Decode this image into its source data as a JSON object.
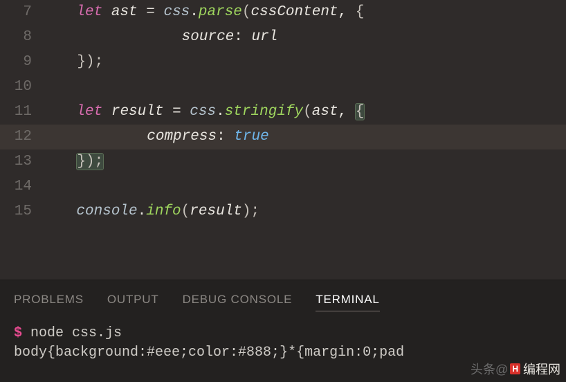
{
  "editor": {
    "lineNumbers": [
      "7",
      "8",
      "9",
      "10",
      "11",
      "12",
      "13",
      "14",
      "15"
    ],
    "l7": {
      "let": "let",
      "ast": "ast",
      "eq": " = ",
      "css": "css",
      "dot": ".",
      "parse": "parse",
      "open": "(",
      "cssContent": "cssContent",
      "comma": ", ",
      "brace": "{"
    },
    "l8": {
      "pad": "            ",
      "source": "source",
      "colon": ": ",
      "url": "url"
    },
    "l9": {
      "pad": "    ",
      "close": "});"
    },
    "l11": {
      "let": "let",
      "result": "result",
      "eq": " = ",
      "css": "css",
      "dot": ".",
      "stringify": "stringify",
      "open": "(",
      "ast": "ast",
      "comma": ", ",
      "brace": "{"
    },
    "l12": {
      "pad": "        ",
      "compress": "compress",
      "colon": ": ",
      "true": "true"
    },
    "l13": {
      "pad": "    ",
      "close": "});"
    },
    "l15": {
      "console": "console",
      "dot": ".",
      "info": "info",
      "open": "(",
      "result": "result",
      "close": ");"
    }
  },
  "panel": {
    "tabs": {
      "problems": "PROBLEMS",
      "output": "OUTPUT",
      "debug": "DEBUG CONSOLE",
      "terminal": "TERMINAL"
    },
    "activeTab": "terminal"
  },
  "terminal": {
    "prompt": "$",
    "cmd": " node css.js",
    "out": "body{background:#eee;color:#888;}*{margin:0;pad"
  },
  "watermark": {
    "prefix": "头条@",
    "badge": "H",
    "text": "编程网"
  }
}
